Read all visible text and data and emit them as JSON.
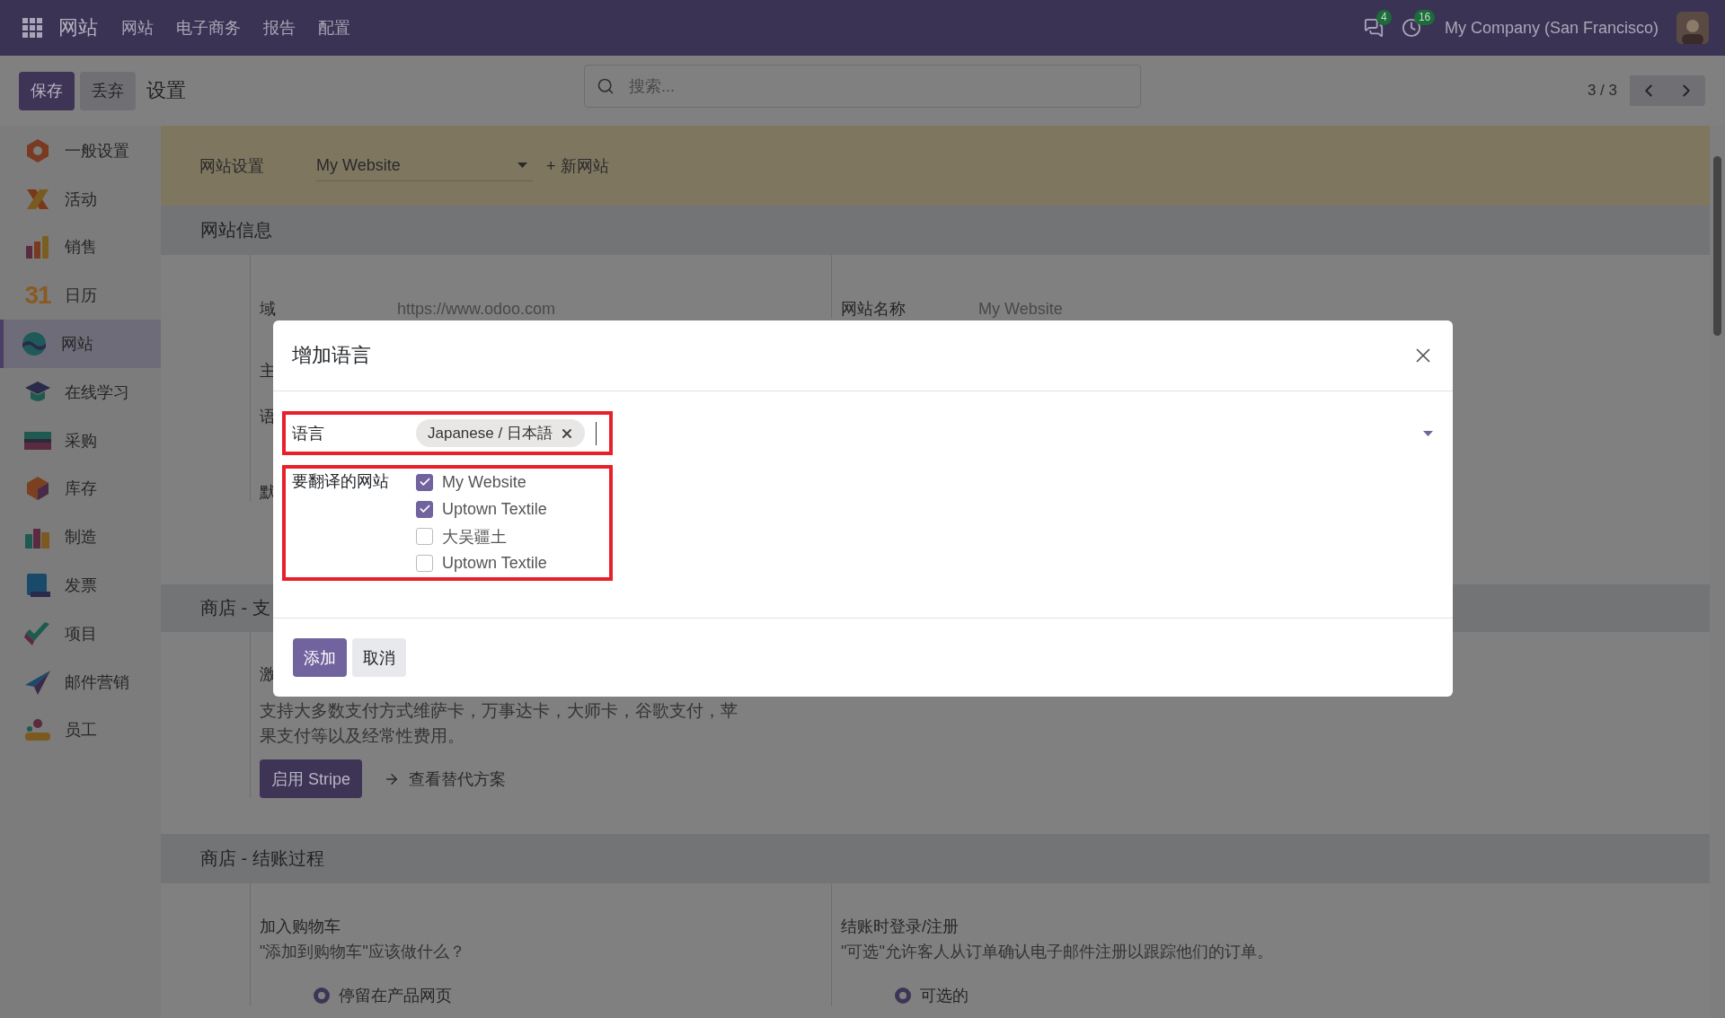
{
  "navbar": {
    "brand": "网站",
    "menus": [
      "网站",
      "电子商务",
      "报告",
      "配置"
    ],
    "messages_badge": "4",
    "activities_badge": "16",
    "company": "My Company (San Francisco)"
  },
  "control_panel": {
    "buttons": [
      {
        "label": "保存",
        "kind": "primary"
      },
      {
        "label": "丢弃",
        "kind": "secondary"
      }
    ],
    "title": "设置",
    "search": {
      "placeholder": "搜索..."
    },
    "pager": "3 / 3"
  },
  "sidebar": {
    "items": [
      {
        "label": "一般设置",
        "selected": false
      },
      {
        "label": "活动",
        "selected": false
      },
      {
        "label": "销售",
        "selected": false
      },
      {
        "label": "日历",
        "selected": false,
        "icon_text": "31"
      },
      {
        "label": "网站",
        "selected": true
      },
      {
        "label": "在线学习",
        "selected": false
      },
      {
        "label": "采购",
        "selected": false
      },
      {
        "label": "库存",
        "selected": false
      },
      {
        "label": "制造",
        "selected": false
      },
      {
        "label": "发票",
        "selected": false
      },
      {
        "label": "项目",
        "selected": false
      },
      {
        "label": "邮件营销",
        "selected": false
      },
      {
        "label": "员工",
        "selected": false
      }
    ]
  },
  "website_bar": {
    "label": "网站设置",
    "website": "My Website",
    "new_link": "+ 新网站"
  },
  "info_section": {
    "title": "网站信息",
    "fields": [
      {
        "label": "域",
        "value": "https://www.odoo.com"
      },
      {
        "label": "网站名称",
        "value": "My Website"
      }
    ],
    "cut_labels": [
      "主",
      "语",
      "默"
    ]
  },
  "payment_section": {
    "title": "商店 - 支",
    "setting_title": "激",
    "description": "支持大多数支付方式维萨卡，万事达卡，大师卡，谷歌支付，苹果支付等以及经常性费用。",
    "button": "启用 Stripe",
    "link": "查看替代方案"
  },
  "checkout_section": {
    "title": "商店 - 结账过程",
    "settings": [
      {
        "title": "加入购物车",
        "description": "\"添加到购物车\"应该做什么？",
        "option": {
          "label": "停留在产品网页",
          "selected": true
        }
      },
      {
        "title": "结账时登录/注册",
        "description": "\"可选\"允许客人从订单确认电子邮件注册以跟踪他们的订单。",
        "option": {
          "label": "可选的",
          "selected": true
        }
      }
    ]
  },
  "dialog": {
    "title": "增加语言",
    "fields": [
      {
        "kind": "tags",
        "label": "语言",
        "tags": [
          "Japanese / 日本語"
        ],
        "highlighted": true
      },
      {
        "kind": "checklist",
        "label": "要翻译的网站",
        "highlighted": true,
        "options": [
          {
            "label": "My Website",
            "checked": true
          },
          {
            "label": "Uptown Textile",
            "checked": true
          },
          {
            "label": "大吴疆土",
            "checked": false
          },
          {
            "label": "Uptown Textile",
            "checked": false
          }
        ]
      }
    ],
    "buttons": [
      {
        "label": "添加",
        "kind": "primary"
      },
      {
        "label": "取消",
        "kind": "secondary"
      }
    ]
  }
}
